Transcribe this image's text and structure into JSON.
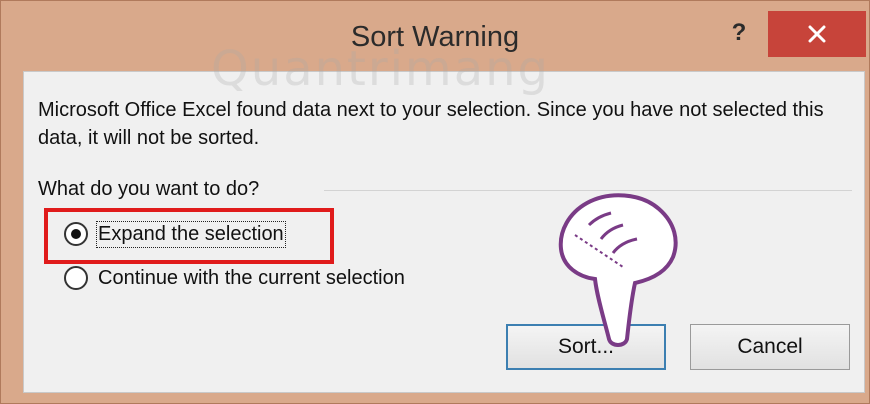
{
  "window": {
    "title": "Sort Warning",
    "help_label": "?",
    "close_icon": "close-icon"
  },
  "message": "Microsoft Office Excel found data next to your selection. Since you have not selected this data, it will not be sorted.",
  "group": {
    "label": "What do you want to do?"
  },
  "options": [
    {
      "label": "Expand the selection",
      "checked": true
    },
    {
      "label": "Continue with the current selection",
      "checked": false
    }
  ],
  "buttons": {
    "sort": "Sort...",
    "cancel": "Cancel"
  },
  "watermark": "Quantrimang",
  "annotation": {
    "highlight_color": "#e01b1b",
    "pointer_icon": "pointing-hand-icon"
  }
}
